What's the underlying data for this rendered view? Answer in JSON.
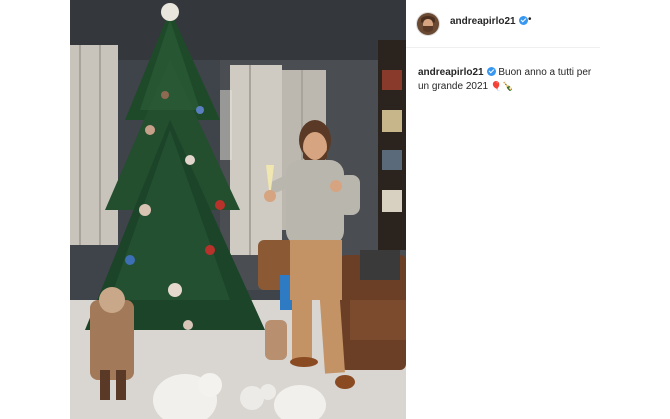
{
  "post": {
    "username": "andreapirlo21",
    "header_separator": "•",
    "caption": {
      "username": "andreapirlo21",
      "text": "Buon anno a tutti per un grande 2021",
      "emojis": "🎈🍾"
    },
    "photo_description_icons": [
      "christmas-tree",
      "person",
      "polar-bear"
    ]
  },
  "colors": {
    "verified": "#3897f0",
    "text": "#262626",
    "border": "#efefef"
  }
}
